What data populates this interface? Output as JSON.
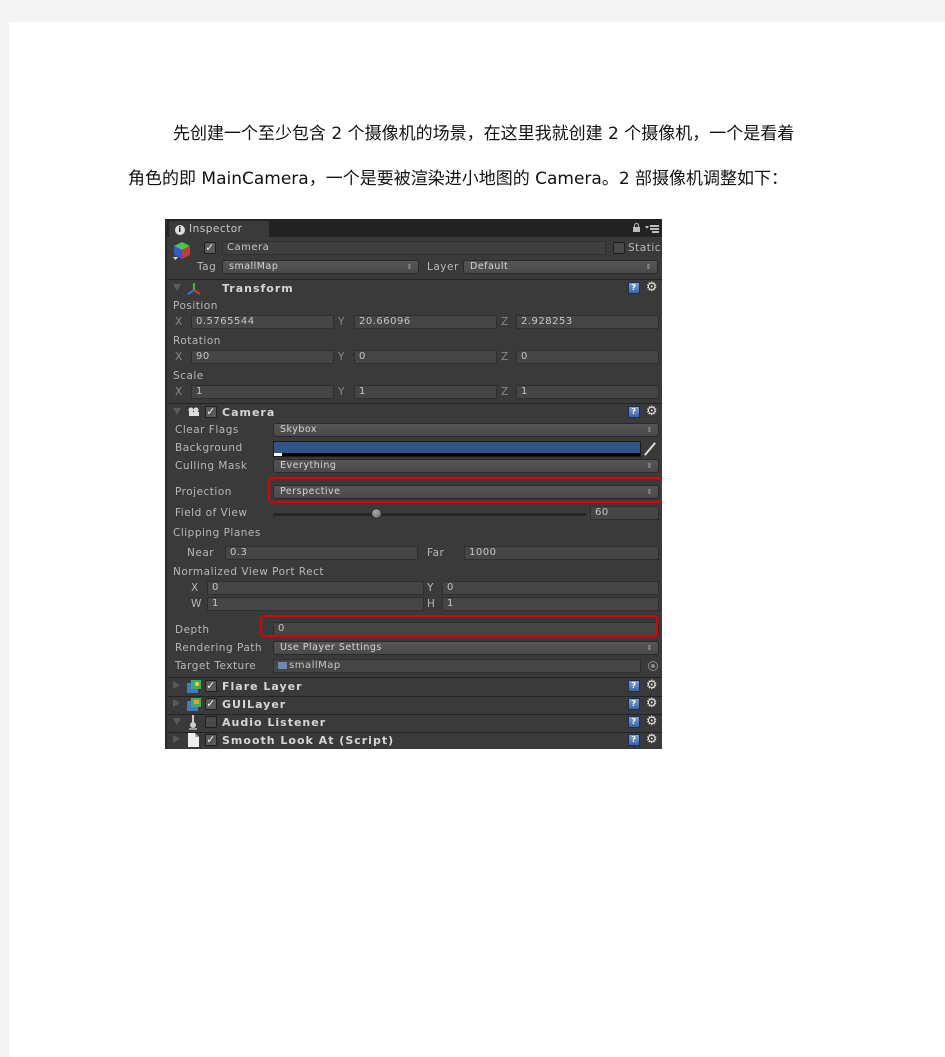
{
  "document": {
    "paragraph_line1": "先创建一个至少包含  2  个摄像机的场景，在这里我就创建  2  个摄像机，一个是看着",
    "paragraph_line2": "角色的即 MainCamera，一个是要被渲染进小地图的 Camera。2 部摄像机调整如下："
  },
  "inspector": {
    "tab_label": "Inspector",
    "object": {
      "active": true,
      "name": "Camera",
      "static_label": "Static",
      "static": false,
      "tag_label": "Tag",
      "tag_value": "smallMap",
      "layer_label": "Layer",
      "layer_value": "Default"
    },
    "transform": {
      "title": "Transform",
      "position_label": "Position",
      "rotation_label": "Rotation",
      "scale_label": "Scale",
      "axis_x": "X",
      "axis_y": "Y",
      "axis_z": "Z",
      "position": {
        "x": "0.5765544",
        "y": "20.66096",
        "z": "2.928253"
      },
      "rotation": {
        "x": "90",
        "y": "0",
        "z": "0"
      },
      "scale": {
        "x": "1",
        "y": "1",
        "z": "1"
      }
    },
    "camera": {
      "title": "Camera",
      "enabled": true,
      "clear_flags_label": "Clear Flags",
      "clear_flags_value": "Skybox",
      "background_label": "Background",
      "background_color": "#31558a",
      "culling_mask_label": "Culling Mask",
      "culling_mask_value": "Everything",
      "projection_label": "Projection",
      "projection_value": "Perspective",
      "fov_label": "Field of View",
      "fov_value": "60",
      "fov_slider_fraction": 0.33,
      "clipping_label": "Clipping Planes",
      "near_label": "Near",
      "near_value": "0.3",
      "far_label": "Far",
      "far_value": "1000",
      "viewport_label": "Normalized View Port Rect",
      "vp_x_label": "X",
      "vp_y_label": "Y",
      "vp_w_label": "W",
      "vp_h_label": "H",
      "vp_x": "0",
      "vp_y": "0",
      "vp_w": "1",
      "vp_h": "1",
      "depth_label": "Depth",
      "depth_value": "0",
      "rendering_path_label": "Rendering Path",
      "rendering_path_value": "Use Player Settings",
      "target_texture_label": "Target Texture",
      "target_texture_value": "smallMap"
    },
    "components": [
      {
        "title": "Flare Layer",
        "enabled": true,
        "icon": "flare-layer-icon"
      },
      {
        "title": "GUILayer",
        "enabled": true,
        "icon": "gui-layer-icon"
      },
      {
        "title": "Audio Listener",
        "enabled": false,
        "icon": "audio-listener-icon"
      },
      {
        "title": "Smooth Look At (Script)",
        "enabled": true,
        "icon": "script-icon"
      }
    ],
    "highlight_color": "#e00000"
  }
}
